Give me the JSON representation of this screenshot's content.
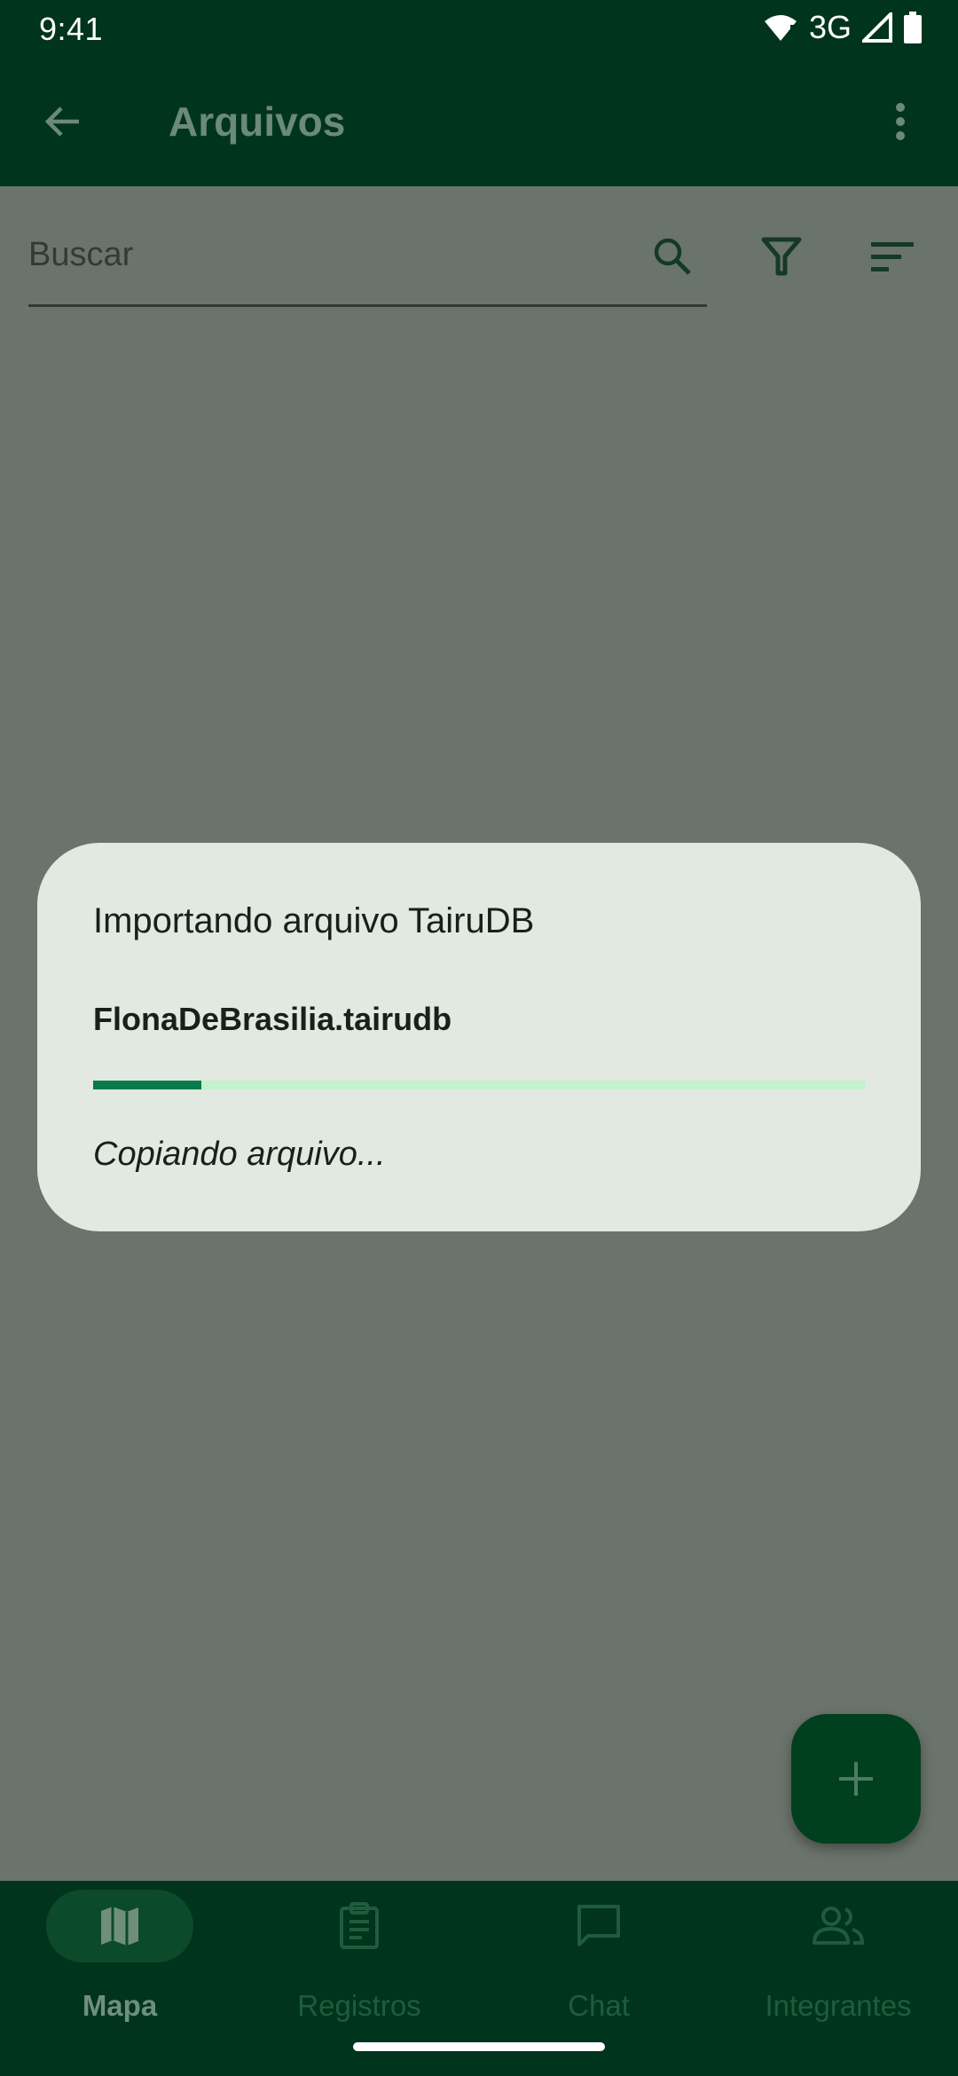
{
  "status_bar": {
    "time": "9:41",
    "network": "3G"
  },
  "app_bar": {
    "title": "Arquivos"
  },
  "search": {
    "placeholder": "Buscar"
  },
  "dialog": {
    "title": "Importando arquivo TairuDB",
    "filename": "FlonaDeBrasilia.tairudb",
    "status": "Copiando arquivo...",
    "progress_fraction": 0.14
  },
  "bottom_nav": {
    "items": [
      {
        "label": "Mapa",
        "icon": "map-icon",
        "active": true
      },
      {
        "label": "Registros",
        "icon": "clipboard-icon",
        "active": false
      },
      {
        "label": "Chat",
        "icon": "chat-icon",
        "active": false
      },
      {
        "label": "Integrantes",
        "icon": "people-icon",
        "active": false
      }
    ]
  },
  "colors": {
    "app_bar": "#00341c",
    "scrim_background": "#6b746c",
    "dialog_background": "#e1e9e1",
    "progress_fill": "#0a7a4a",
    "progress_track": "#c3f2cc",
    "fab": "#00401f"
  }
}
